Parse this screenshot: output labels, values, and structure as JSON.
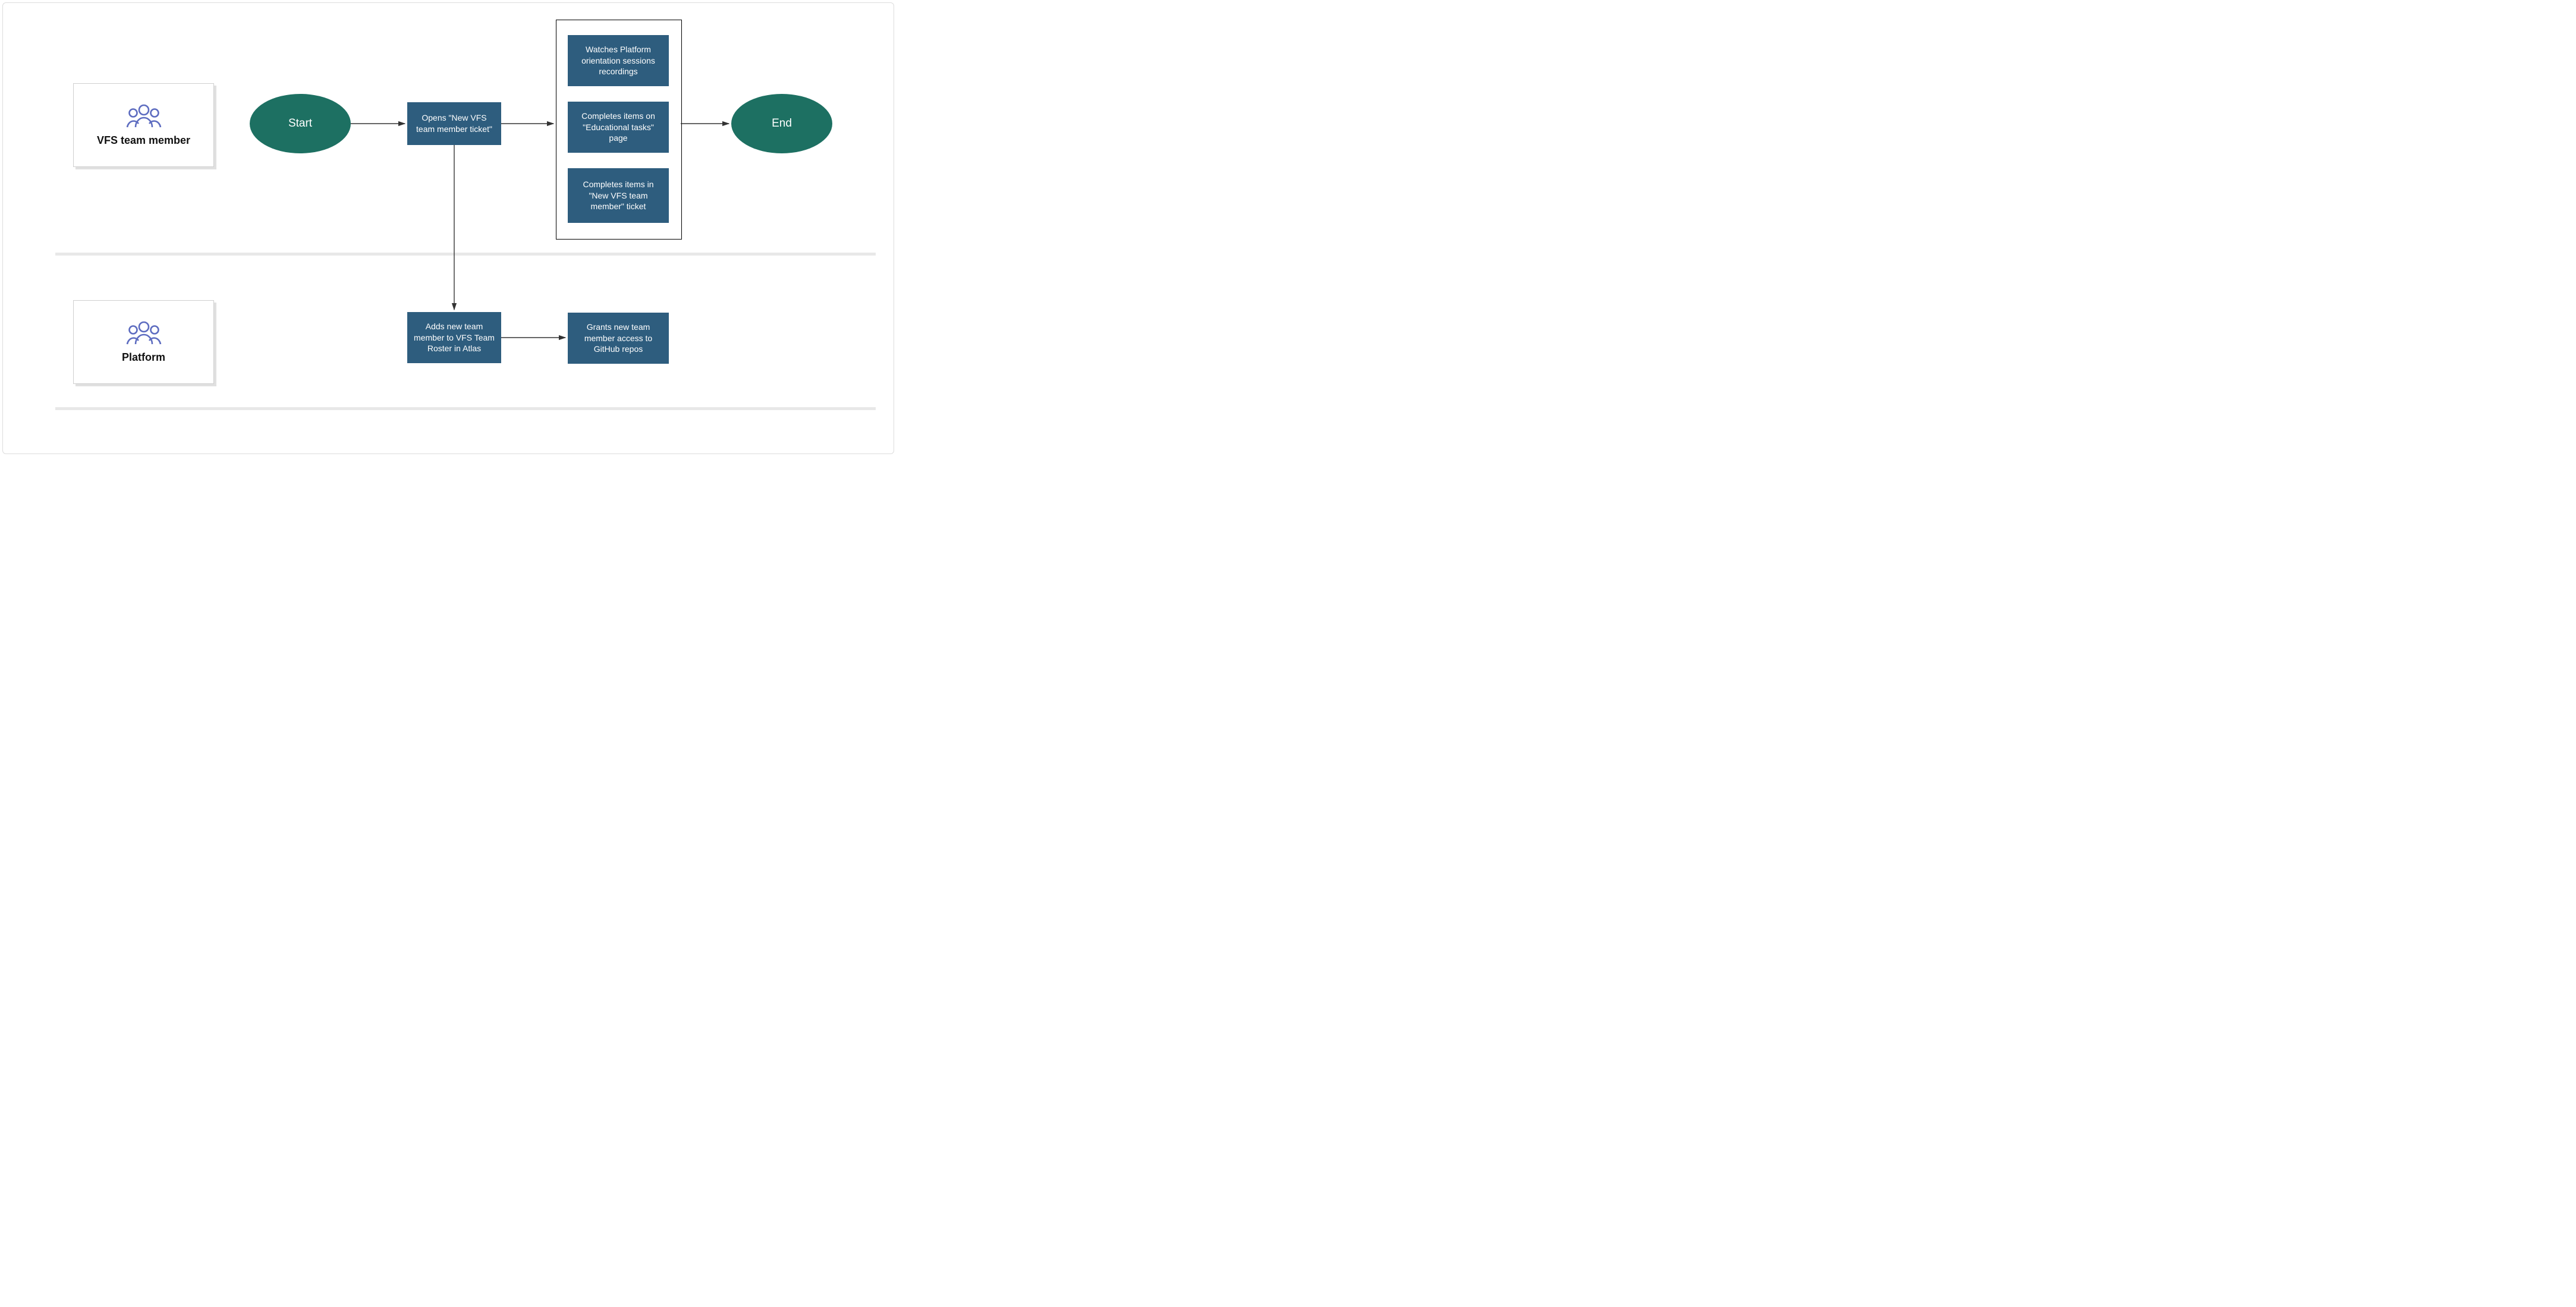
{
  "lanes": {
    "vfs": {
      "label": "VFS team member"
    },
    "platform": {
      "label": "Platform"
    }
  },
  "nodes": {
    "start": "Start",
    "open_ticket": "Opens \"New VFS team member ticket\"",
    "watch_recordings": "Watches Platform orientation sessions recordings",
    "edu_tasks": "Completes items on \"Educational tasks\" page",
    "complete_ticket": "Completes items in \"New VFS team member\" ticket",
    "end": "End",
    "add_roster": "Adds new team member to VFS Team Roster in Atlas",
    "grant_access": "Grants new team member access to GitHub repos"
  },
  "colors": {
    "ellipse": "#1d7062",
    "box": "#2e5d7e",
    "icon": "#5d6cc0"
  }
}
